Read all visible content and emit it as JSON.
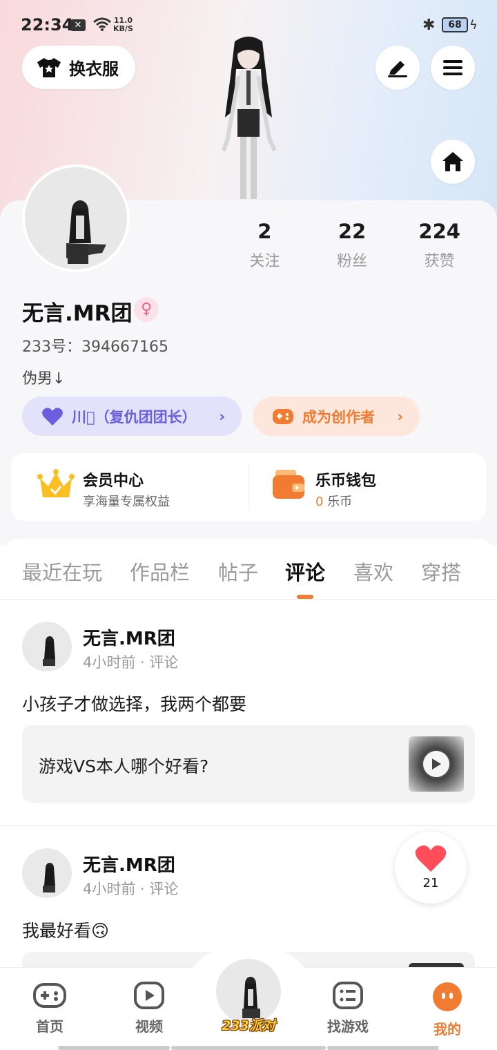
{
  "status_bar": {
    "time": "22:34",
    "net_speed_value": "11.0",
    "net_speed_unit": "KB/S",
    "battery": "68"
  },
  "header": {
    "outfit_button": "换衣服"
  },
  "profile": {
    "stats": [
      {
        "num": "2",
        "label": "关注"
      },
      {
        "num": "22",
        "label": "粉丝"
      },
      {
        "num": "224",
        "label": "获赞"
      }
    ],
    "username": "无言.MR团",
    "uid": "233号：394667165",
    "bio": "伪男↓",
    "team_pill": "川\u0000（复仇团团长）",
    "creator_pill": "成为创作者"
  },
  "cards": {
    "vip": {
      "title": "会员中心",
      "subtitle": "享海量专属权益"
    },
    "wallet": {
      "title": "乐币钱包",
      "amount": "0",
      "unit": " 乐币"
    }
  },
  "tabs": [
    "最近在玩",
    "作品栏",
    "帖子",
    "评论",
    "喜欢",
    "穿搭"
  ],
  "active_tab": "评论",
  "posts": [
    {
      "name": "无言.MR团",
      "meta": "4小时前 · 评论",
      "text": "小孩子才做选择，我两个都要",
      "ref": "游戏VS本人哪个好看?"
    },
    {
      "name": "无言.MR团",
      "meta": "4小时前 · 评论",
      "text": "我最好看🙃"
    }
  ],
  "like_count": "21",
  "bottom_nav": {
    "home": "首页",
    "video": "视频",
    "brand": "233派对",
    "find_game": "找游戏",
    "mine": "我的"
  },
  "colors": {
    "accent": "#f17b30",
    "team": "#6a5fe0"
  }
}
